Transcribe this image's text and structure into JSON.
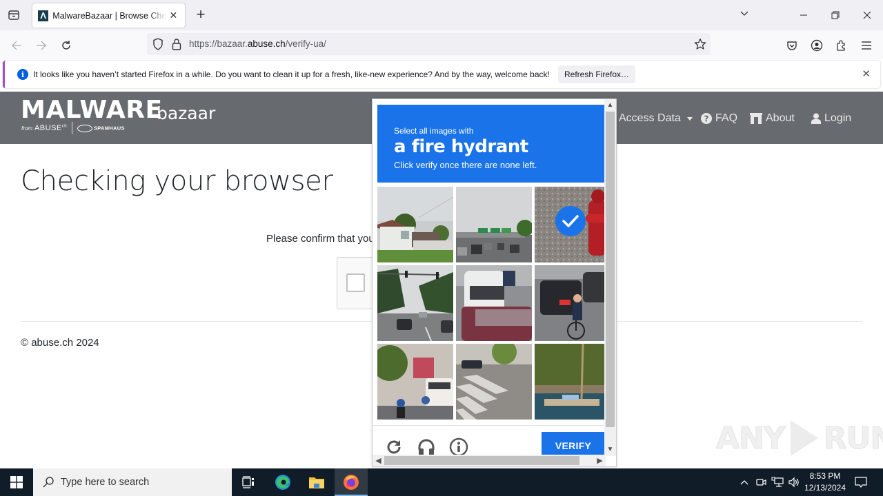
{
  "browser": {
    "tab": {
      "title": "MalwareBazaar | Browse Checking your browser",
      "favicon_glyph": "Λ"
    },
    "new_tab": "+",
    "url": {
      "prefix": "https://bazaar.",
      "domain": "abuse.ch",
      "path": "/verify-ua/"
    },
    "window_controls": {
      "minimize": "—",
      "restore": "❐",
      "close": "✕"
    },
    "notification": {
      "message": "It looks like you haven’t started Firefox in a while. Do you want to clean it up for a fresh, like-new experience? And by the way, welcome back!",
      "button": "Refresh Firefox…",
      "close": "✕"
    }
  },
  "site": {
    "logo": {
      "main": "MALWARE",
      "sub": "bazaar",
      "from": "from",
      "abuse": "ABUSE",
      "abuse_sup": "ch",
      "spamhaus": "SPAMHAUS"
    },
    "nav": [
      {
        "label": "Access Data",
        "icon": "caret-down-icon"
      },
      {
        "label": "FAQ",
        "icon": "question-circle-icon"
      },
      {
        "label": "About",
        "icon": "building-icon"
      },
      {
        "label": "Login",
        "icon": "user-icon"
      }
    ],
    "title": "Checking your browser",
    "confirm_text": "Please confirm that you are not a robot",
    "footer": "© abuse.ch 2024"
  },
  "captcha": {
    "instruction_small": "Select all images with",
    "target": "a fire hydrant",
    "instruction_hint": "Click verify once there are none left.",
    "verify_label": "VERIFY",
    "tiles": [
      {
        "scene": "house-with-fence",
        "selected": false
      },
      {
        "scene": "highway-overpass",
        "selected": false
      },
      {
        "scene": "fire-hydrant",
        "selected": true
      },
      {
        "scene": "road-traffic-lights",
        "selected": false
      },
      {
        "scene": "white-van-red-car",
        "selected": false
      },
      {
        "scene": "child-on-bicycle",
        "selected": false
      },
      {
        "scene": "street-with-bus",
        "selected": false
      },
      {
        "scene": "crosswalk",
        "selected": false
      },
      {
        "scene": "boat-on-water",
        "selected": false
      }
    ],
    "footer_icons": [
      "reload-icon",
      "audio-headphones-icon",
      "info-icon"
    ]
  },
  "watermark": {
    "left": "ANY",
    "right": "RUN"
  },
  "taskbar": {
    "search_placeholder": "Type here to search",
    "time": "8:53 PM",
    "date": "12/13/2024"
  }
}
